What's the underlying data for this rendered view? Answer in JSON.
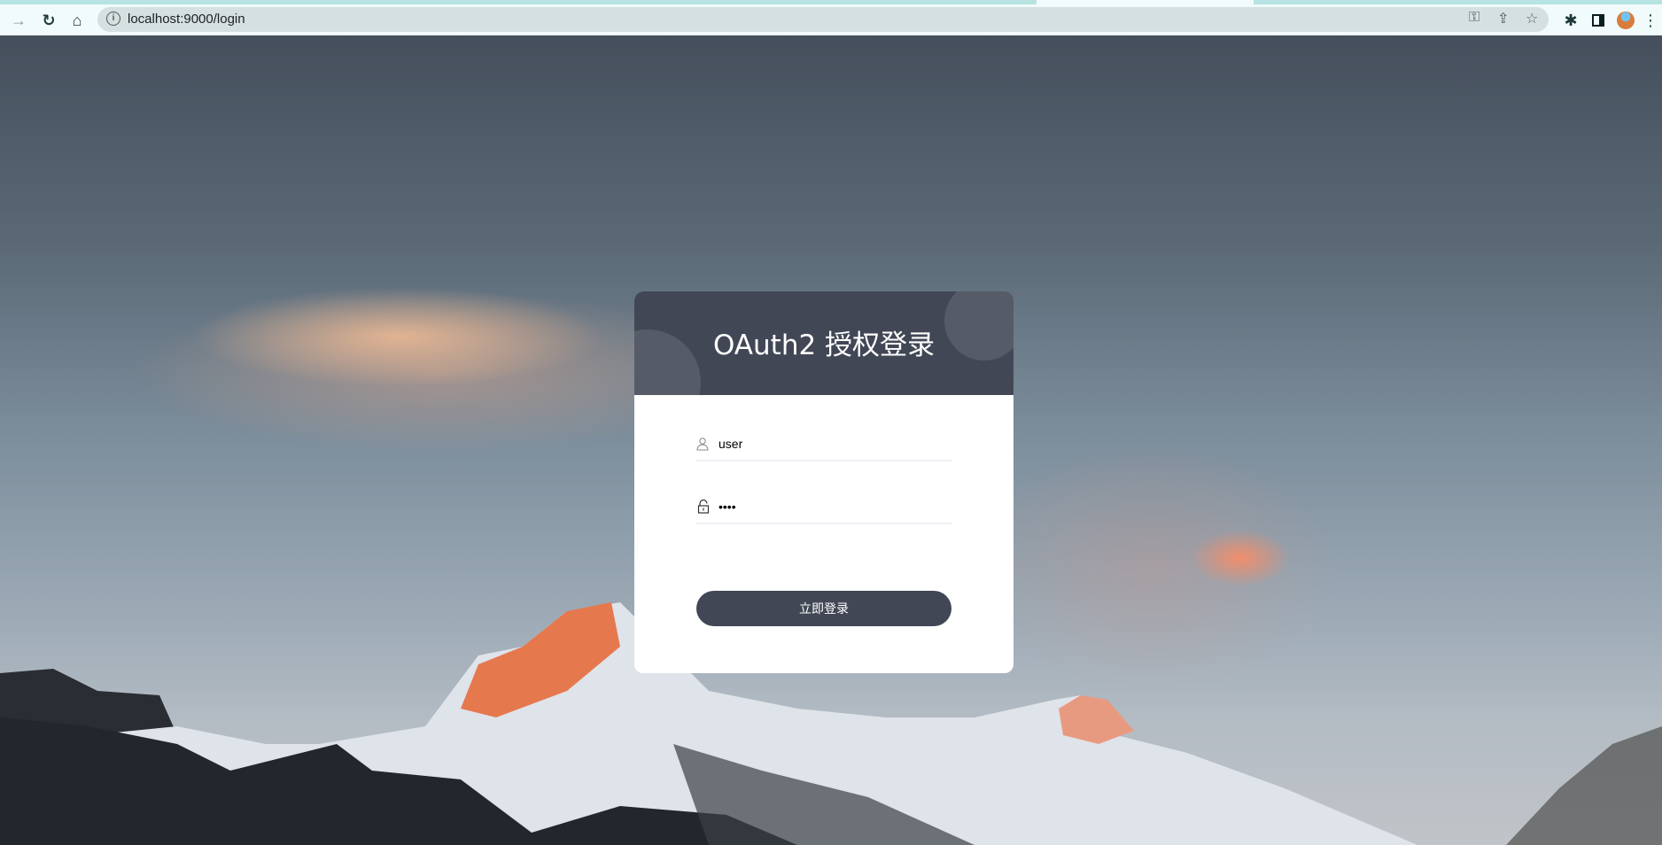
{
  "browser": {
    "url": "localhost:9000/login",
    "icons": [
      "forward-icon",
      "reload-icon",
      "home-icon",
      "info-icon",
      "key-icon",
      "share-icon",
      "star-icon",
      "extensions-icon",
      "sidepanel-icon",
      "avatar",
      "menu-icon"
    ]
  },
  "login": {
    "title": "OAuth2 授权登录",
    "username": "user",
    "password": "1234",
    "submit_label": "立即登录"
  },
  "colors": {
    "primary": "#424756",
    "accent_circle": "#565b68"
  }
}
